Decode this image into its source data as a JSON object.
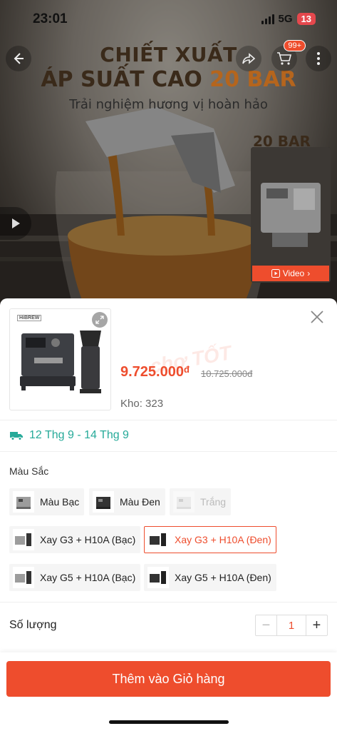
{
  "status_bar": {
    "time": "23:01",
    "network": "5G",
    "battery": "13"
  },
  "hero": {
    "headline_line1": "CHIẾT XUẤT",
    "headline_line2_prefix": "ÁP SUẤT CAO ",
    "headline_line2_number": "20 BAR",
    "tagline": "Trải nghiệm hương vị hoàn hảo",
    "cart_badge": "99+",
    "video_header": "20 BAR",
    "video_label": "Video",
    "icons": {
      "back": "arrow-left-icon",
      "share": "share-icon",
      "cart": "cart-icon",
      "more": "more-dots-icon",
      "play": "play-icon"
    }
  },
  "product": {
    "brand_tag": "HiBREW",
    "price": "9.725.000",
    "price_currency": "đ",
    "old_price": "10.725.000đ",
    "watermark": "chợ TỐT",
    "stock_label": "Kho: 323"
  },
  "delivery": {
    "dates": "12 Thg 9 - 14 Thg 9",
    "icon": "truck-icon"
  },
  "variants": {
    "label": "Màu Sắc",
    "options": [
      {
        "label": "Màu Bạc",
        "state": "normal"
      },
      {
        "label": "Màu Đen",
        "state": "normal"
      },
      {
        "label": "Trắng",
        "state": "disabled"
      },
      {
        "label": "Xay G3 + H10A (Bạc)",
        "state": "normal"
      },
      {
        "label": "Xay G3 + H10A (Đen)",
        "state": "selected"
      },
      {
        "label": "Xay G5 + H10A (Bạc)",
        "state": "normal"
      },
      {
        "label": "Xay G5 + H10A (Đen)",
        "state": "normal"
      }
    ]
  },
  "quantity": {
    "label": "Số lượng",
    "minus": "−",
    "value": "1",
    "plus": "+"
  },
  "cta": {
    "add_to_cart": "Thêm vào Giỏ hàng"
  },
  "colors": {
    "accent": "#ee4d2d",
    "delivery": "#26aa99"
  }
}
